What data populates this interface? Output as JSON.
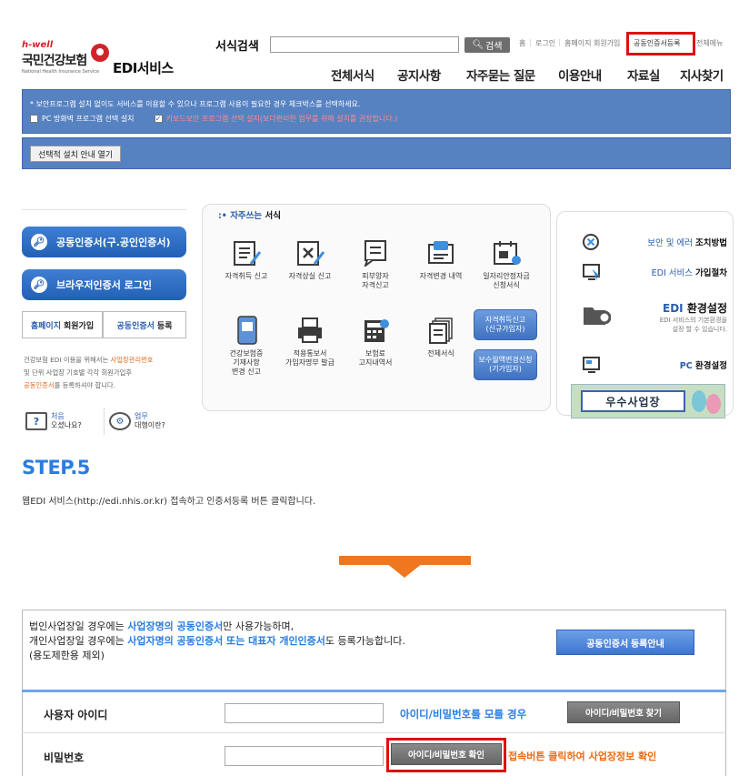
{
  "header": {
    "logo_brand": "h-well",
    "logo_name": "국민건강보험",
    "logo_sub": "National Health Insurance Service",
    "service_title": "EDI서비스",
    "search_label": "서식검색",
    "search_value": "",
    "search_button": "검색",
    "util_links": [
      "홈",
      "로그인",
      "홈페이지 회원가입"
    ],
    "util_cert_register": "공동인증서등록",
    "util_all_menu": "전체메뉴",
    "gnb": [
      "전체서식",
      "공지사항",
      "자주묻는 질문",
      "이용안내",
      "자료실",
      "지사찾기"
    ]
  },
  "notice": {
    "line1": "* 보안프로그램 설치 없이도 서비스를 이용할 수 있으나 프로그램 사용이 필요한 경우 체크박스를 선택하세요.",
    "option1": "PC 방화벽 프로그램 선택 설치",
    "option2": "키보드보안 프로그램 선택 설치(보다편리한 업무를 위해 설치를 권장합니다.)",
    "guide_button": "선택적 설치 안내 열기"
  },
  "left_panel": {
    "cert_login": "공동인증서(구.공인인증서)",
    "browser_login": "브라우저인증서 로그인",
    "tab_join_hl": "홈페이지",
    "tab_join": "회원가입",
    "tab_cert_hl": "공동인증서",
    "tab_cert": "등록",
    "desc_1": "건강보험 EDI 이용을 위해서는 ",
    "desc_or1": "사업장관리번호",
    "desc_2": "및 단위 사업장 기호별 각각 회원가입후",
    "desc_or2": "공동인증서",
    "desc_3": "를 등록하셔야 합니다.",
    "first_time": [
      "처음",
      "오셨나요?"
    ],
    "task_rep": [
      "업무",
      "대행이란?"
    ]
  },
  "freq": {
    "title_hl": "자주쓰는",
    "title": "서식",
    "items": [
      "자격취득 신고",
      "자격상실 신고",
      "피부양자\n자격신고",
      "자격변경 내역",
      "일자리안정자금\n신청서식",
      "건강보험증\n기재사항\n변경 신고",
      "적용통보서\n가입자명부 발급",
      "보험료\n고지내역서",
      "전체서식"
    ],
    "btn_acq": "자격취득신고\n(신규가입자)",
    "btn_monthly": "보수월액변경신청\n(기가입자)"
  },
  "right_panel": {
    "security_hl": "보안 및 에러",
    "security": "조치방법",
    "join_hl": "EDI 서비스",
    "join": "가입절차",
    "env_hl": "EDI",
    "env": "환경설정",
    "env_desc": "EDI 서비스의 기본환경을\n설정 할 수 있습니다.",
    "pc_hl": "PC",
    "pc": "환경설정",
    "best": "우수사업장"
  },
  "step": {
    "title": "STEP.5",
    "desc": "웹EDI 서비스(http://edi.nhis.or.kr) 접속하고 인증서등록 버튼 클릭합니다."
  },
  "form": {
    "info1_a": "법인사업장일 경우에는 ",
    "info1_hl": "사업장명의 공동인증서",
    "info1_b": "만 사용가능하며,",
    "info2_a": "개인사업장일 경우에는 ",
    "info2_hl": "사업자명의 공동인증서 또는 대표자 개인인증서",
    "info2_b": "도 등록가능합니다.",
    "info3": "(용도제한용 제외)",
    "guide_button": "공동인증서 등록안내",
    "user_id_label": "사용자 아이디",
    "user_id_value": "",
    "forgot_hint": "아이디/비밀번호를 모를 경우",
    "find_button": "아이디/비밀번호 찾기",
    "password_label": "비밀번호",
    "password_value": "",
    "confirm_button": "아이디/비밀번호 확인",
    "confirm_hint": "접속버튼 클릭하여 사업장정보 확인"
  },
  "colors": {
    "accent_blue": "#2a7de1",
    "highlight_red": "#dd1111",
    "orange": "#ee7720",
    "notice_blue": "#5782c2"
  }
}
